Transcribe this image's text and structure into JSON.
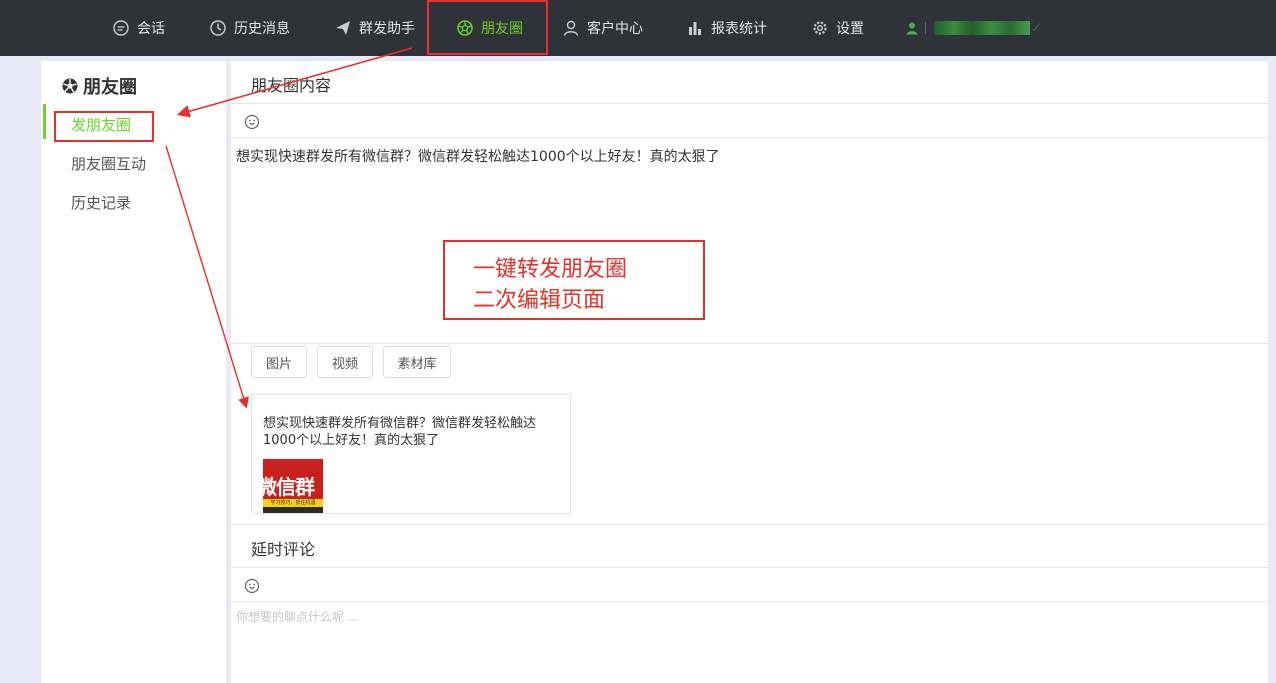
{
  "nav": {
    "items": [
      {
        "label": "会话",
        "icon": "chat-icon"
      },
      {
        "label": "历史消息",
        "icon": "clock-icon"
      },
      {
        "label": "群发助手",
        "icon": "send-icon"
      },
      {
        "label": "朋友圈",
        "icon": "moments-icon",
        "active": true
      },
      {
        "label": "客户中心",
        "icon": "user-icon"
      },
      {
        "label": "报表统计",
        "icon": "bar-chart-icon"
      },
      {
        "label": "设置",
        "icon": "gear-icon"
      }
    ],
    "user_icon": "user-icon"
  },
  "sidebar": {
    "title": "朋友圈",
    "title_icon": "moments-icon",
    "items": [
      {
        "label": "发朋友圈",
        "active": true
      },
      {
        "label": "朋友圈互动"
      },
      {
        "label": "历史记录"
      }
    ]
  },
  "main": {
    "content_title": "朋友圈内容",
    "content_text": "想实现快速群发所有微信群？微信群发轻松触达1000个以上好友！真的太狠了",
    "buttons": [
      "图片",
      "视频",
      "素材库"
    ],
    "preview": {
      "text": "想实现快速群发所有微信群？微信群发轻松触达1000个以上好友！真的太狠了",
      "thumb_text": "微信群",
      "thumb_band": "学习技巧，抓住机遇"
    },
    "comment_title": "延时评论",
    "comment_placeholder": "你想要的聊点什么呢 ..."
  },
  "annotation": {
    "line1": "一键转发朋友圈",
    "line2": "二次编辑页面"
  },
  "colors": {
    "topbar": "#2f3238",
    "accent_green": "#6fd12a",
    "annotation_red": "#e8302a"
  }
}
